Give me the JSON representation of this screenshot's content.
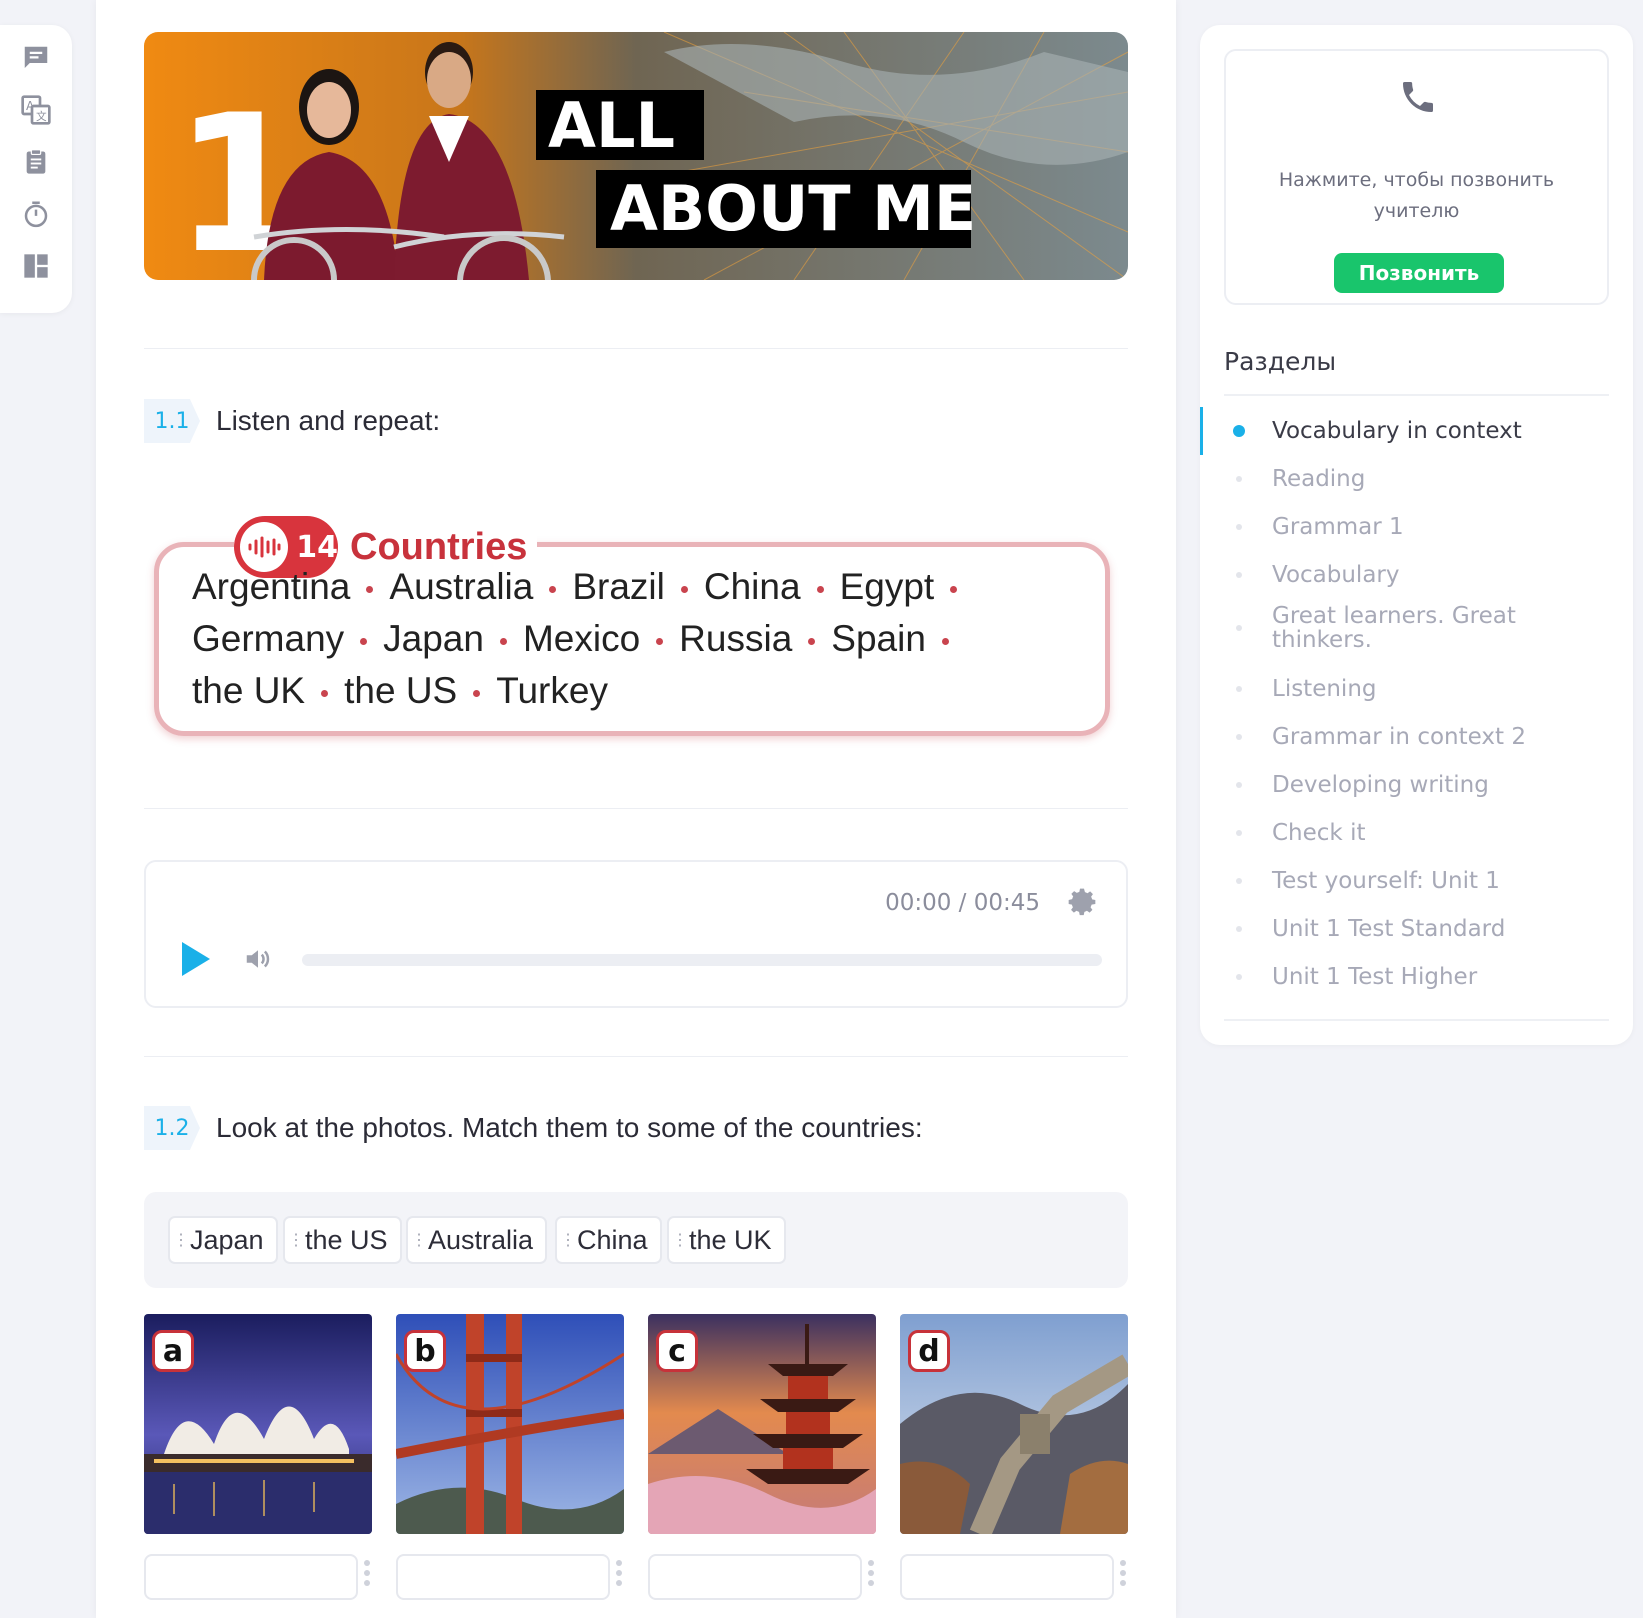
{
  "rail": {
    "icons": [
      "chat-icon",
      "translate-icon",
      "clipboard-icon",
      "timer-icon",
      "layout-icon"
    ]
  },
  "banner": {
    "unit_number": "1",
    "title_line1": "ALL",
    "title_line2": "ABOUT ME"
  },
  "exercise1": {
    "number": "1.1",
    "title": "Listen and repeat:",
    "track_number": "14",
    "box_title": "Countries",
    "lines": [
      [
        "Argentina",
        "Australia",
        "Brazil",
        "China",
        "Egypt"
      ],
      [
        "Germany",
        "Japan",
        "Mexico",
        "Russia",
        "Spain"
      ],
      [
        "the UK",
        "the US",
        "Turkey"
      ]
    ]
  },
  "audio": {
    "time": "00:00 / 00:45",
    "progress": 0
  },
  "exercise2": {
    "number": "1.2",
    "title": "Look at the photos. Match them to some of the countries:",
    "chips": [
      "Japan",
      "the US",
      "Australia",
      "China",
      "the UK"
    ],
    "photos": [
      {
        "label": "a",
        "answer": ""
      },
      {
        "label": "b",
        "answer": ""
      },
      {
        "label": "c",
        "answer": ""
      },
      {
        "label": "d",
        "answer": ""
      }
    ]
  },
  "sidebar": {
    "call_text": "Нажмите, чтобы позвонить учителю",
    "call_button": "Позвонить",
    "sections_title": "Разделы",
    "sections": [
      "Vocabulary in context",
      "Reading",
      "Grammar 1",
      "Vocabulary",
      "Great learners. Great thinkers.",
      "Listening",
      "Grammar in context 2",
      "Developing writing",
      "Check it",
      "Test yourself: Unit 1",
      "Unit 1 Test Standard",
      "Unit 1 Test Higher"
    ],
    "active_index": 0
  },
  "colors": {
    "accent": "#1ab0e8",
    "call_green": "#19c56c",
    "brand_red": "#c8323c"
  }
}
